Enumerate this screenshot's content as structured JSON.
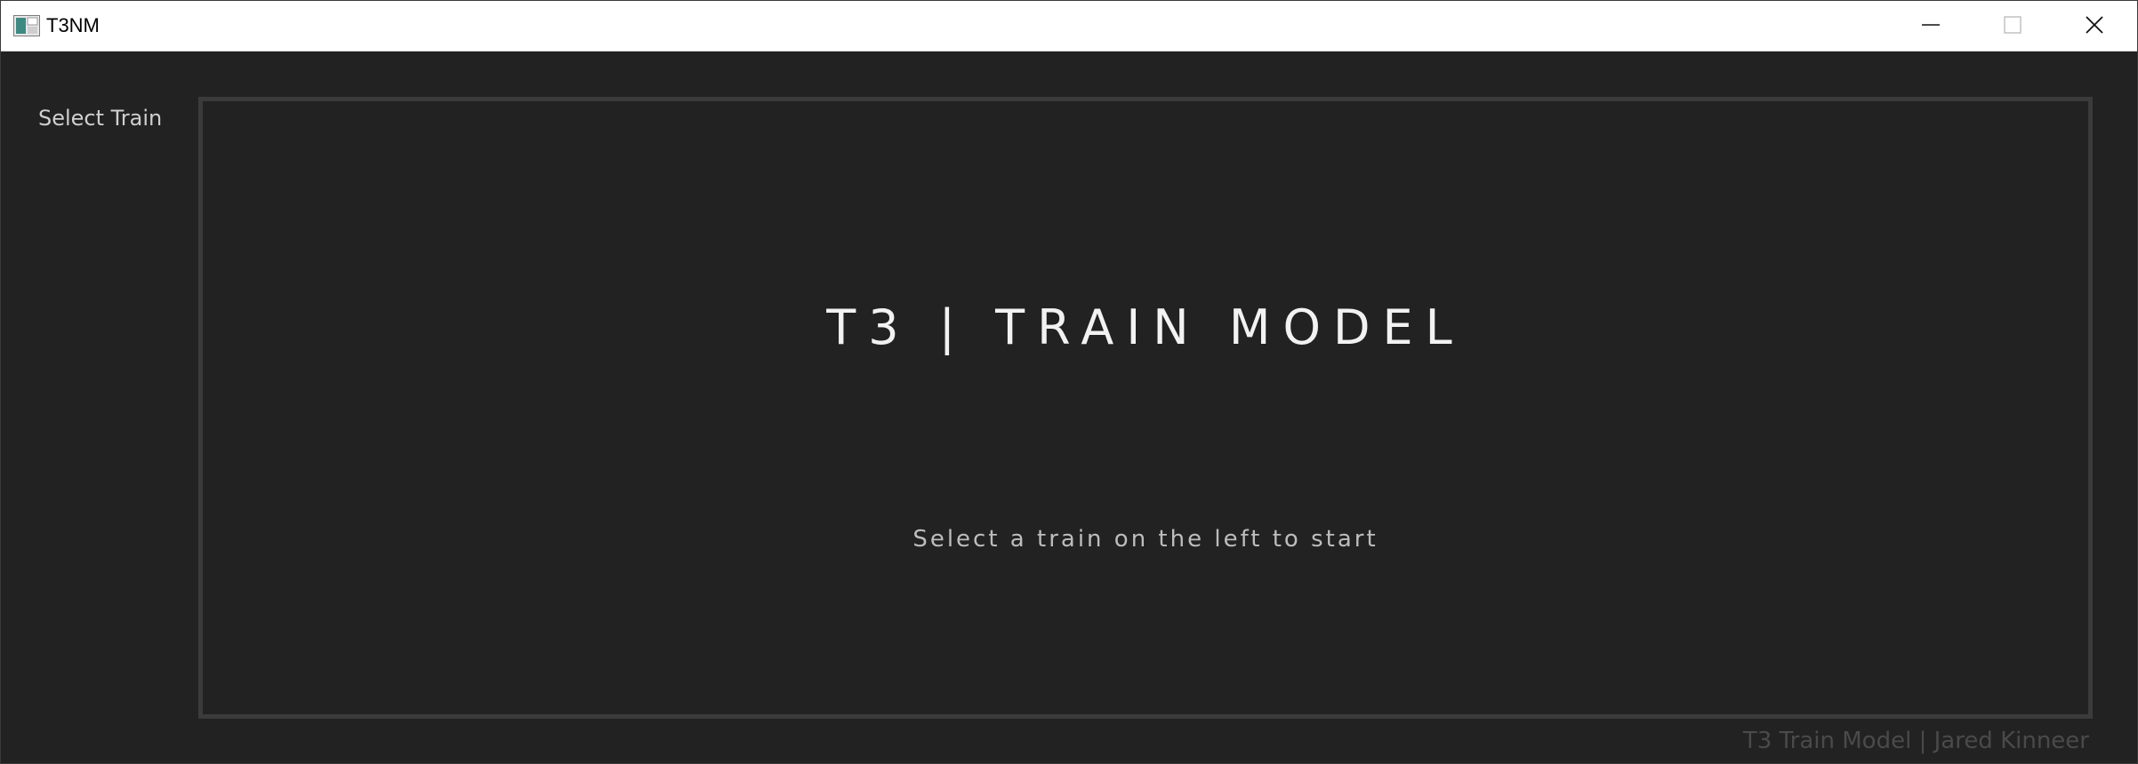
{
  "window": {
    "title": "T3NM",
    "icons": {
      "app": "app-icon",
      "minimize": "minimize-icon",
      "maximize": "maximize-icon",
      "close": "close-icon"
    }
  },
  "sidebar": {
    "title": "Select Train"
  },
  "main": {
    "heading": "T3 | TRAIN MODEL",
    "subtext": "Select a train on the left to start"
  },
  "footer": {
    "credit": "T3 Train Model | Jared Kinneer"
  },
  "colors": {
    "background": "#222222",
    "panel_border": "#3b3b3b",
    "heading_text": "#f2f2f2",
    "subtext": "#bdbdbd",
    "footer_text": "#4a4a4a"
  }
}
